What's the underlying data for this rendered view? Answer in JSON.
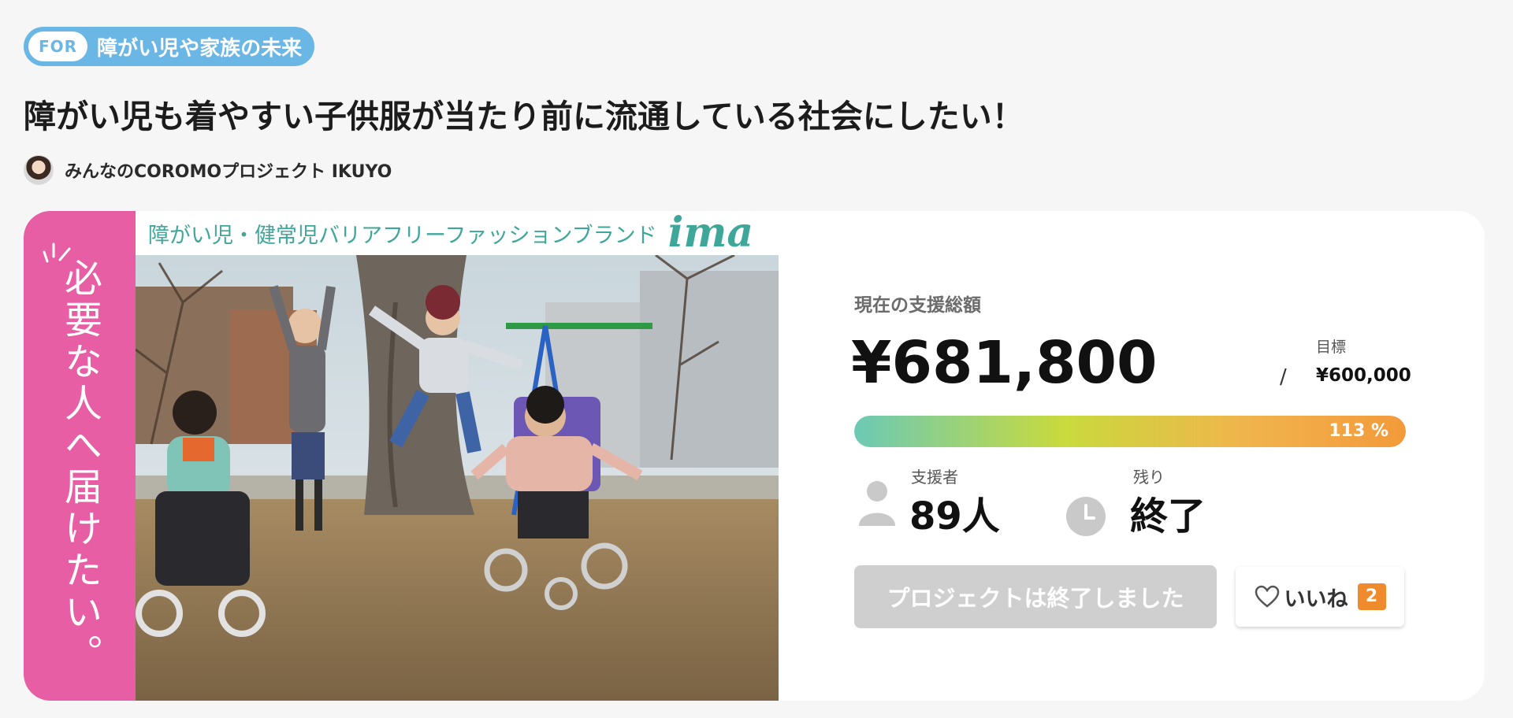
{
  "tag": {
    "prefix": "FOR",
    "text": "障がい児や家族の未来"
  },
  "project": {
    "title": "障がい児も着やすい子供服が当たり前に流通している社会にしたい！",
    "owner": "みんなのCOROMOプロジェクト IKUYO"
  },
  "banner": {
    "vertical_message": "必要な人へ届けたい。",
    "tagline": "障がい児・健常児バリアフリーファッションブランド",
    "brand": "ima",
    "photo_icon": "children-jumping-photo"
  },
  "stats": {
    "current_label": "現在の支援総額",
    "current_amount": "¥681,800",
    "goal_label": "目標",
    "goal_separator": "/",
    "goal_amount": "¥600,000",
    "progress_text": "113 %",
    "progress_value": 113,
    "backers_label": "支援者",
    "backers_value": "89人",
    "remaining_label": "残り",
    "remaining_value": "終了"
  },
  "actions": {
    "ended_button": "プロジェクトは終了しました",
    "like_label": "いいね",
    "like_count": "2"
  },
  "colors": {
    "tag_blue": "#6ab7e6",
    "pink": "#e75ea5",
    "brand_teal": "#3fa79a",
    "like_orange": "#ef8a2d"
  }
}
